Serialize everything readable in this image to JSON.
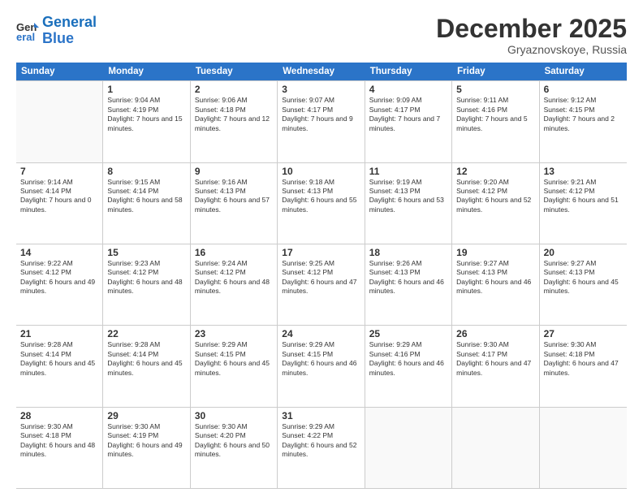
{
  "logo": {
    "line1": "General",
    "line2": "Blue"
  },
  "title": "December 2025",
  "location": "Gryaznovskoye, Russia",
  "header_days": [
    "Sunday",
    "Monday",
    "Tuesday",
    "Wednesday",
    "Thursday",
    "Friday",
    "Saturday"
  ],
  "weeks": [
    [
      {
        "day": "",
        "sunrise": "",
        "sunset": "",
        "daylight": ""
      },
      {
        "day": "1",
        "sunrise": "Sunrise: 9:04 AM",
        "sunset": "Sunset: 4:19 PM",
        "daylight": "Daylight: 7 hours and 15 minutes."
      },
      {
        "day": "2",
        "sunrise": "Sunrise: 9:06 AM",
        "sunset": "Sunset: 4:18 PM",
        "daylight": "Daylight: 7 hours and 12 minutes."
      },
      {
        "day": "3",
        "sunrise": "Sunrise: 9:07 AM",
        "sunset": "Sunset: 4:17 PM",
        "daylight": "Daylight: 7 hours and 9 minutes."
      },
      {
        "day": "4",
        "sunrise": "Sunrise: 9:09 AM",
        "sunset": "Sunset: 4:17 PM",
        "daylight": "Daylight: 7 hours and 7 minutes."
      },
      {
        "day": "5",
        "sunrise": "Sunrise: 9:11 AM",
        "sunset": "Sunset: 4:16 PM",
        "daylight": "Daylight: 7 hours and 5 minutes."
      },
      {
        "day": "6",
        "sunrise": "Sunrise: 9:12 AM",
        "sunset": "Sunset: 4:15 PM",
        "daylight": "Daylight: 7 hours and 2 minutes."
      }
    ],
    [
      {
        "day": "7",
        "sunrise": "Sunrise: 9:14 AM",
        "sunset": "Sunset: 4:14 PM",
        "daylight": "Daylight: 7 hours and 0 minutes."
      },
      {
        "day": "8",
        "sunrise": "Sunrise: 9:15 AM",
        "sunset": "Sunset: 4:14 PM",
        "daylight": "Daylight: 6 hours and 58 minutes."
      },
      {
        "day": "9",
        "sunrise": "Sunrise: 9:16 AM",
        "sunset": "Sunset: 4:13 PM",
        "daylight": "Daylight: 6 hours and 57 minutes."
      },
      {
        "day": "10",
        "sunrise": "Sunrise: 9:18 AM",
        "sunset": "Sunset: 4:13 PM",
        "daylight": "Daylight: 6 hours and 55 minutes."
      },
      {
        "day": "11",
        "sunrise": "Sunrise: 9:19 AM",
        "sunset": "Sunset: 4:13 PM",
        "daylight": "Daylight: 6 hours and 53 minutes."
      },
      {
        "day": "12",
        "sunrise": "Sunrise: 9:20 AM",
        "sunset": "Sunset: 4:12 PM",
        "daylight": "Daylight: 6 hours and 52 minutes."
      },
      {
        "day": "13",
        "sunrise": "Sunrise: 9:21 AM",
        "sunset": "Sunset: 4:12 PM",
        "daylight": "Daylight: 6 hours and 51 minutes."
      }
    ],
    [
      {
        "day": "14",
        "sunrise": "Sunrise: 9:22 AM",
        "sunset": "Sunset: 4:12 PM",
        "daylight": "Daylight: 6 hours and 49 minutes."
      },
      {
        "day": "15",
        "sunrise": "Sunrise: 9:23 AM",
        "sunset": "Sunset: 4:12 PM",
        "daylight": "Daylight: 6 hours and 48 minutes."
      },
      {
        "day": "16",
        "sunrise": "Sunrise: 9:24 AM",
        "sunset": "Sunset: 4:12 PM",
        "daylight": "Daylight: 6 hours and 48 minutes."
      },
      {
        "day": "17",
        "sunrise": "Sunrise: 9:25 AM",
        "sunset": "Sunset: 4:12 PM",
        "daylight": "Daylight: 6 hours and 47 minutes."
      },
      {
        "day": "18",
        "sunrise": "Sunrise: 9:26 AM",
        "sunset": "Sunset: 4:13 PM",
        "daylight": "Daylight: 6 hours and 46 minutes."
      },
      {
        "day": "19",
        "sunrise": "Sunrise: 9:27 AM",
        "sunset": "Sunset: 4:13 PM",
        "daylight": "Daylight: 6 hours and 46 minutes."
      },
      {
        "day": "20",
        "sunrise": "Sunrise: 9:27 AM",
        "sunset": "Sunset: 4:13 PM",
        "daylight": "Daylight: 6 hours and 45 minutes."
      }
    ],
    [
      {
        "day": "21",
        "sunrise": "Sunrise: 9:28 AM",
        "sunset": "Sunset: 4:14 PM",
        "daylight": "Daylight: 6 hours and 45 minutes."
      },
      {
        "day": "22",
        "sunrise": "Sunrise: 9:28 AM",
        "sunset": "Sunset: 4:14 PM",
        "daylight": "Daylight: 6 hours and 45 minutes."
      },
      {
        "day": "23",
        "sunrise": "Sunrise: 9:29 AM",
        "sunset": "Sunset: 4:15 PM",
        "daylight": "Daylight: 6 hours and 45 minutes."
      },
      {
        "day": "24",
        "sunrise": "Sunrise: 9:29 AM",
        "sunset": "Sunset: 4:15 PM",
        "daylight": "Daylight: 6 hours and 46 minutes."
      },
      {
        "day": "25",
        "sunrise": "Sunrise: 9:29 AM",
        "sunset": "Sunset: 4:16 PM",
        "daylight": "Daylight: 6 hours and 46 minutes."
      },
      {
        "day": "26",
        "sunrise": "Sunrise: 9:30 AM",
        "sunset": "Sunset: 4:17 PM",
        "daylight": "Daylight: 6 hours and 47 minutes."
      },
      {
        "day": "27",
        "sunrise": "Sunrise: 9:30 AM",
        "sunset": "Sunset: 4:18 PM",
        "daylight": "Daylight: 6 hours and 47 minutes."
      }
    ],
    [
      {
        "day": "28",
        "sunrise": "Sunrise: 9:30 AM",
        "sunset": "Sunset: 4:18 PM",
        "daylight": "Daylight: 6 hours and 48 minutes."
      },
      {
        "day": "29",
        "sunrise": "Sunrise: 9:30 AM",
        "sunset": "Sunset: 4:19 PM",
        "daylight": "Daylight: 6 hours and 49 minutes."
      },
      {
        "day": "30",
        "sunrise": "Sunrise: 9:30 AM",
        "sunset": "Sunset: 4:20 PM",
        "daylight": "Daylight: 6 hours and 50 minutes."
      },
      {
        "day": "31",
        "sunrise": "Sunrise: 9:29 AM",
        "sunset": "Sunset: 4:22 PM",
        "daylight": "Daylight: 6 hours and 52 minutes."
      },
      {
        "day": "",
        "sunrise": "",
        "sunset": "",
        "daylight": ""
      },
      {
        "day": "",
        "sunrise": "",
        "sunset": "",
        "daylight": ""
      },
      {
        "day": "",
        "sunrise": "",
        "sunset": "",
        "daylight": ""
      }
    ]
  ]
}
